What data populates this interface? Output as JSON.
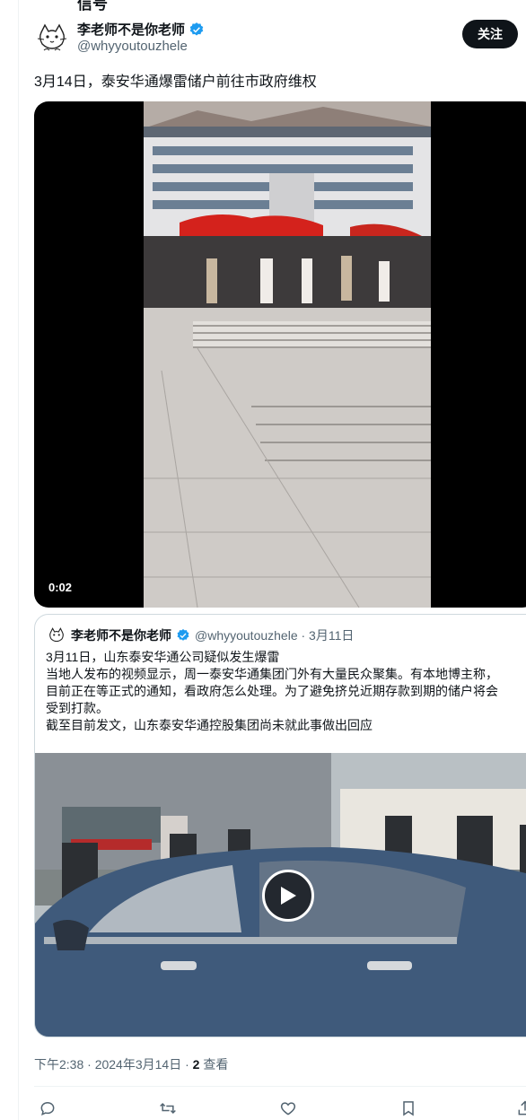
{
  "prev_fragment": "信号",
  "author": {
    "name": "李老师不是你老师",
    "handle": "@whyyoutouzhele",
    "follow_label": "关注"
  },
  "tweet": {
    "text": "3月14日，泰安华通爆雷储户前往市政府维权",
    "video_time": "0:02"
  },
  "quoted": {
    "name": "李老师不是你老师",
    "handle_date": "@whyyoutouzhele · 3月11日",
    "lines": [
      "3月11日，山东泰安华通公司疑似发生爆雷",
      "当地人发布的视频显示，周一泰安华通集团门外有大量民众聚集。有本地博主称，",
      "目前正在等正式的通知，看政府怎么处理。为了避免挤兑近期存款到期的储户将会",
      "受到打款。",
      "截至目前发文，山东泰安华通控股集团尚未就此事做出回应"
    ]
  },
  "meta": {
    "time_date": "下午2:38 · 2024年3月14日 · ",
    "views_count": "2",
    "views_label": " 查看"
  },
  "icons": {
    "reply": "reply-icon",
    "retweet": "retweet-icon",
    "like": "heart-icon",
    "bookmark": "bookmark-icon",
    "share": "share-icon",
    "verified": "verified-badge-icon",
    "play": "play-icon"
  },
  "colors": {
    "verified_blue": "#1d9bf0",
    "text_secondary": "#536471",
    "follow_bg": "#0f1419"
  }
}
